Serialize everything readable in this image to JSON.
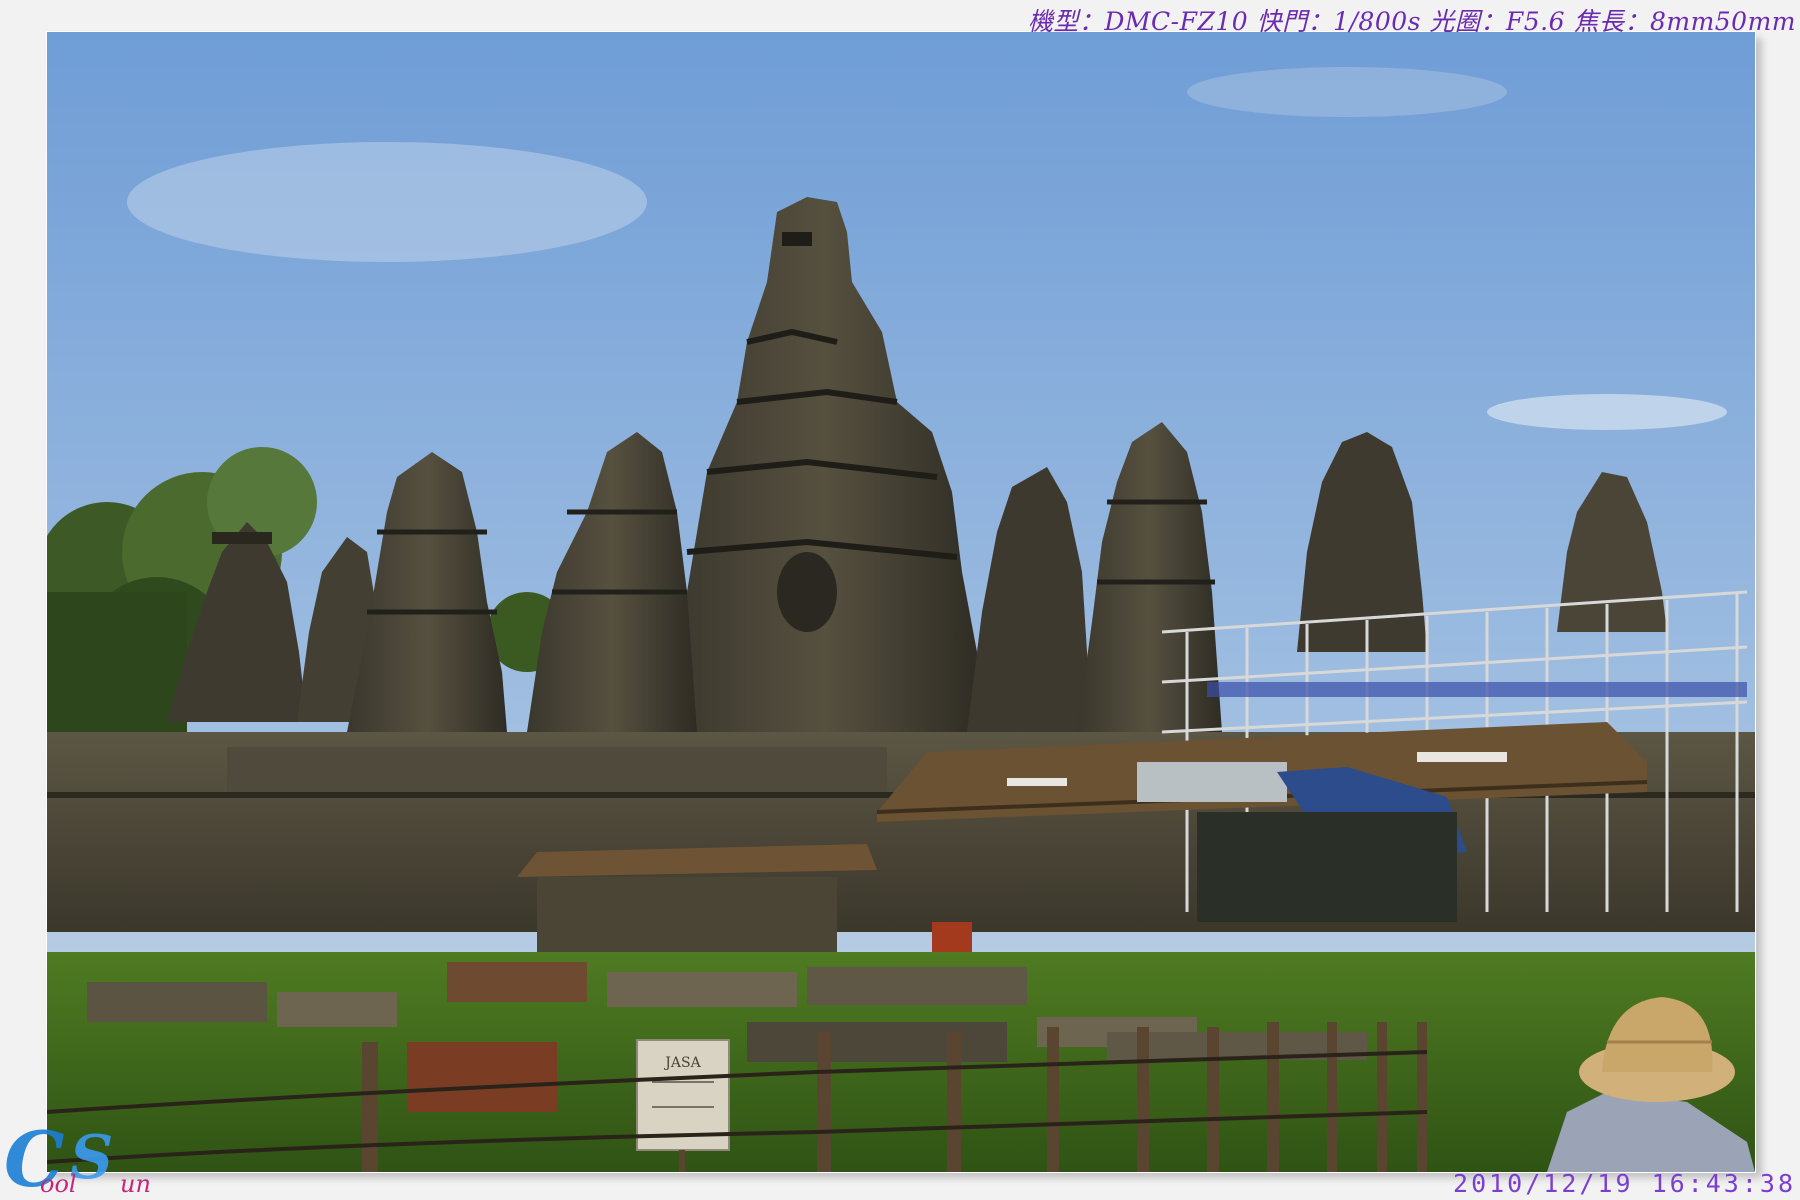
{
  "exif": {
    "text": "機型：DMC-FZ10 快門：1/800s 光圈：F5.6 焦長：8mm50mm"
  },
  "timestamp": {
    "text": "2010/12/19  16:43:38"
  },
  "photo": {
    "sign_text": "JASA"
  },
  "logo": {
    "text": "CoolSun"
  },
  "colors": {
    "sky_top": "#6f9dd6",
    "sky_bottom": "#c5d6e8",
    "stone_dark": "#2c2a22",
    "stone_mid": "#4b463a",
    "grass": "#3e6a1e",
    "exif_text": "#6a2bb0",
    "logo_blue": "#1c7fd6"
  }
}
